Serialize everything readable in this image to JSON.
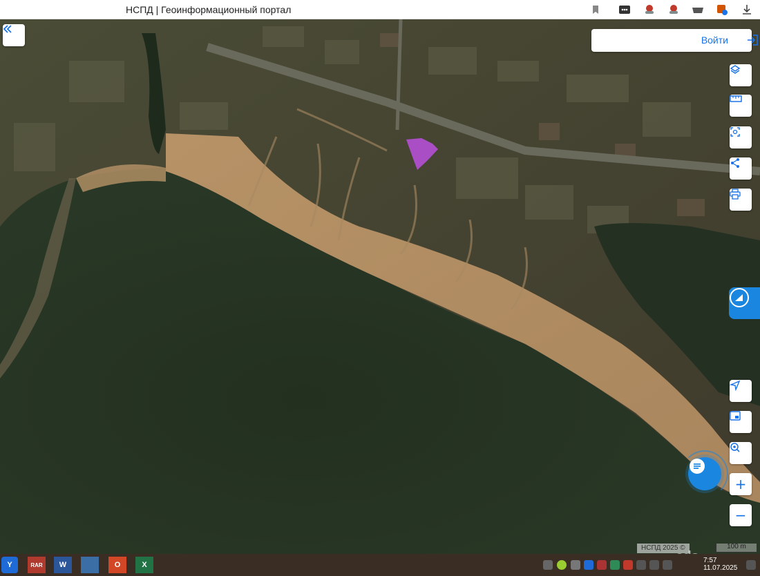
{
  "browser": {
    "title": "НСПД | Геоинформационный портал",
    "toolbar_icons": [
      "bookmark-icon",
      "extensions-icon",
      "profile-icon",
      "profile-alt-icon",
      "downloads-drawer-icon",
      "badge-icon",
      "download-icon"
    ]
  },
  "map": {
    "collapse_icon": "double-chevron-left-icon",
    "login_label": "Войти",
    "right_tools": [
      "layers-icon",
      "ruler-icon",
      "select-area-icon",
      "share-icon",
      "print-icon"
    ],
    "bottom_tools": [
      "locate-icon",
      "picture-in-picture-icon",
      "search-location-icon"
    ],
    "zoom_in": "+",
    "zoom_out": "−",
    "attribution": "НСПД 2025 ©",
    "scale_label": "100 m",
    "watermark": "ads",
    "parcel_color": "#b24fd0"
  },
  "taskbar": {
    "start_label": "Y",
    "apps": [
      {
        "name": "archiver",
        "label": "RAR",
        "color": "#b03a2e"
      },
      {
        "name": "word",
        "label": "W",
        "color": "#2b579a"
      },
      {
        "name": "network-tool",
        "label": "",
        "color": "#3a6ea5"
      },
      {
        "name": "powerpoint",
        "label": "O",
        "color": "#d24726"
      },
      {
        "name": "excel",
        "label": "X",
        "color": "#217346"
      }
    ],
    "clock_time": "7:57",
    "clock_date": "11.07.2025"
  }
}
